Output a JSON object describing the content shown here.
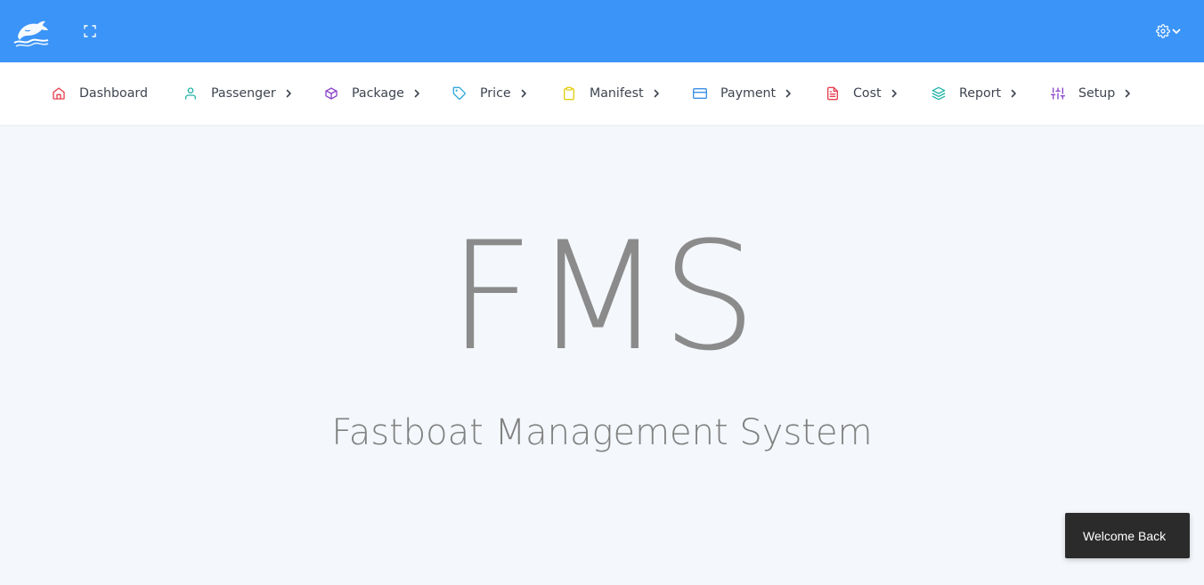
{
  "topbar": {
    "logo_icon": "dolphin-logo-icon",
    "fullscreen_icon": "fullscreen-icon",
    "settings_icon": "gear-icon",
    "dropdown_icon": "chevron-down-icon",
    "background_color": "#3b94f7"
  },
  "nav": {
    "items": [
      {
        "label": "Dashboard",
        "icon": "home-icon",
        "color": "#e5404f",
        "has_submenu": false
      },
      {
        "label": "Passenger",
        "icon": "user-icon",
        "color": "#1fb2a6",
        "has_submenu": true
      },
      {
        "label": "Package",
        "icon": "box-icon",
        "color": "#8b44c9",
        "has_submenu": true
      },
      {
        "label": "Price",
        "icon": "tag-icon",
        "color": "#30a8dc",
        "has_submenu": true
      },
      {
        "label": "Manifest",
        "icon": "clipboard-icon",
        "color": "#e3cf12",
        "has_submenu": true
      },
      {
        "label": "Payment",
        "icon": "credit-card-icon",
        "color": "#3b8ee6",
        "has_submenu": true
      },
      {
        "label": "Cost",
        "icon": "file-text-icon",
        "color": "#e5404f",
        "has_submenu": true
      },
      {
        "label": "Report",
        "icon": "layers-icon",
        "color": "#1fb2a6",
        "has_submenu": true
      },
      {
        "label": "Setup",
        "icon": "sliders-icon",
        "color": "#8b44c9",
        "has_submenu": true
      }
    ]
  },
  "hero": {
    "title": "FMS",
    "subtitle": "Fastboat Management System"
  },
  "toast": {
    "message": "Welcome Back"
  }
}
